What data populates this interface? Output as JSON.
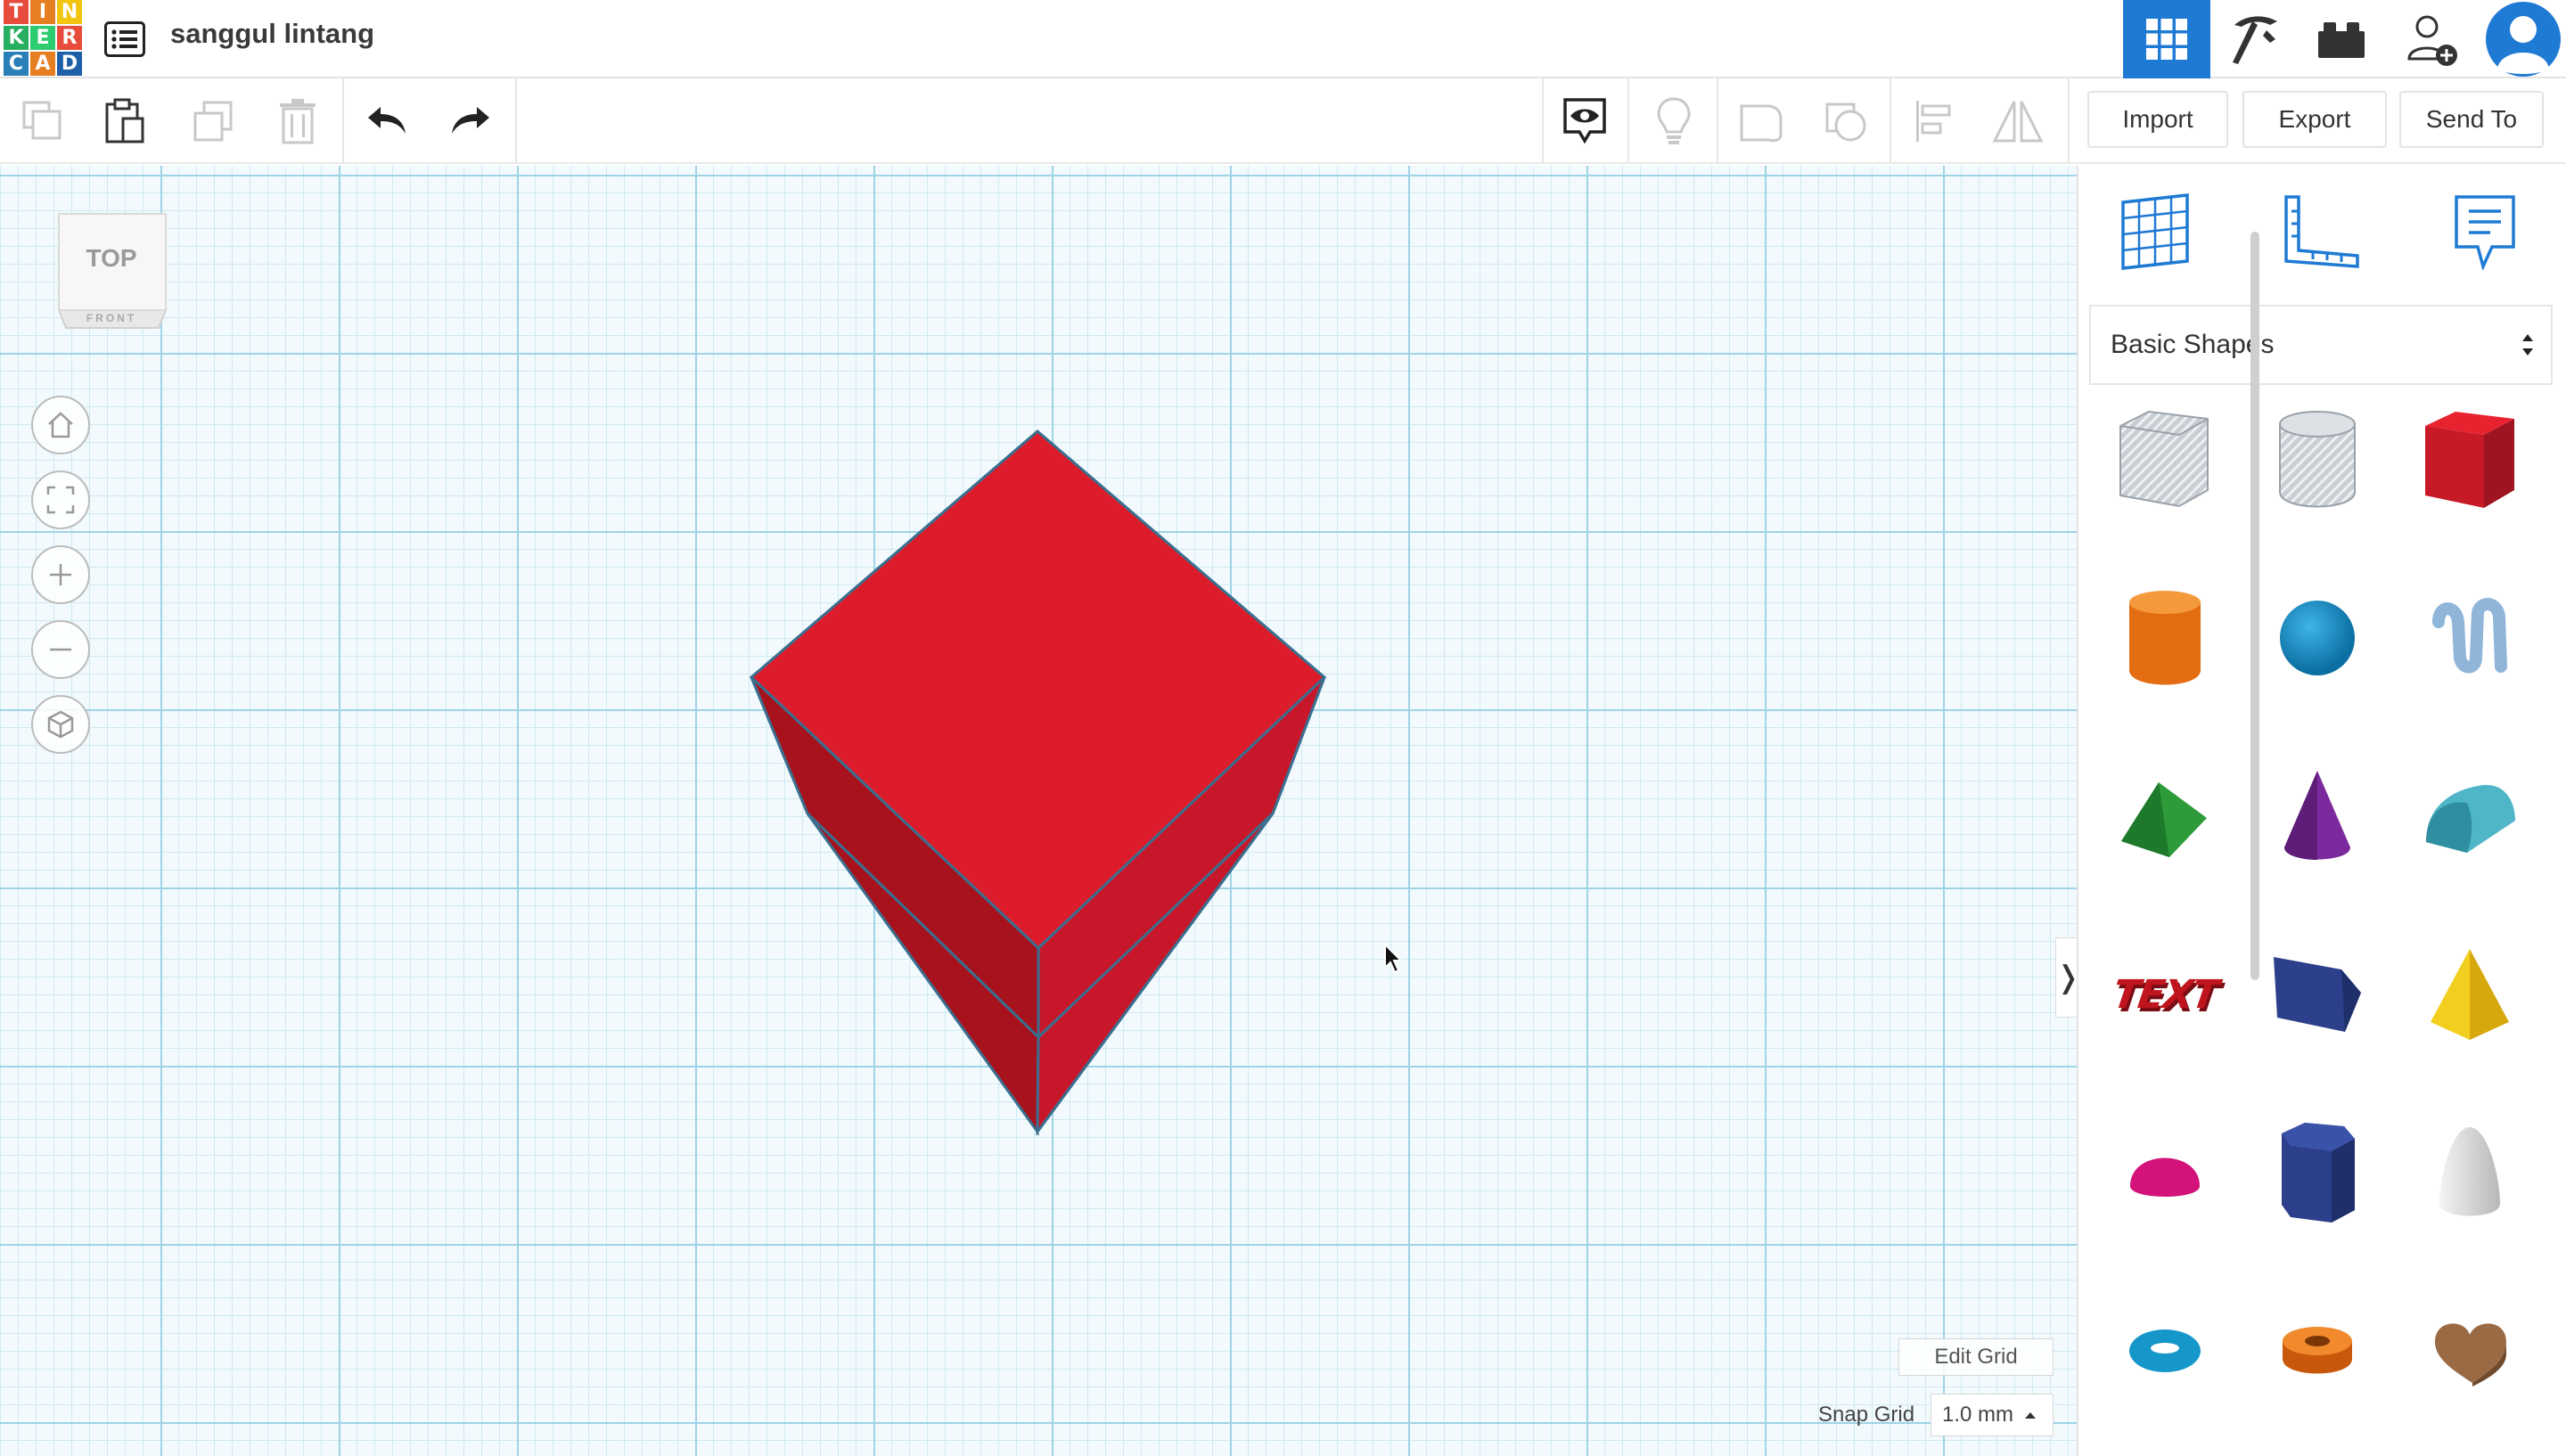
{
  "app": {
    "logo_letters": [
      "T",
      "I",
      "N",
      "K",
      "E",
      "R",
      "C",
      "A",
      "D"
    ],
    "logo_colors": [
      "#e74c3c",
      "#e67e22",
      "#f1c40f",
      "#27ae60",
      "#2ecc71",
      "#e74c3c",
      "#2980b9",
      "#e67e22",
      "#1e5fa8"
    ],
    "design_title": "sanggul lintang"
  },
  "topbar": {
    "right_icons": [
      "3d-design-grid-icon",
      "codeblocks-pickaxe-icon",
      "lego-brick-icon",
      "invite-user-icon",
      "user-avatar-icon"
    ],
    "accent": "#1f7ad4"
  },
  "toolbar": {
    "import_label": "Import",
    "export_label": "Export",
    "send_to_label": "Send To"
  },
  "workplane": {
    "viewcube_top": "TOP",
    "viewcube_front": "FRONT",
    "shape_color": "#dd1c2b",
    "edit_grid_label": "Edit Grid",
    "snap_grid_label": "Snap Grid",
    "snap_grid_value": "1.0 mm"
  },
  "panel": {
    "category": "Basic Shapes",
    "shapes": [
      {
        "name": "box-hole-shape"
      },
      {
        "name": "cylinder-hole-shape"
      },
      {
        "name": "box-shape"
      },
      {
        "name": "cylinder-shape"
      },
      {
        "name": "sphere-shape"
      },
      {
        "name": "scribble-shape"
      },
      {
        "name": "roof-shape"
      },
      {
        "name": "cone-shape"
      },
      {
        "name": "round-roof-shape"
      },
      {
        "name": "text-shape",
        "text": "TEXT"
      },
      {
        "name": "wedge-shape"
      },
      {
        "name": "pyramid-shape"
      },
      {
        "name": "half-sphere-shape"
      },
      {
        "name": "polygon-shape"
      },
      {
        "name": "paraboloid-shape"
      },
      {
        "name": "torus-shape"
      },
      {
        "name": "tube-shape"
      },
      {
        "name": "heart-shape"
      }
    ]
  }
}
